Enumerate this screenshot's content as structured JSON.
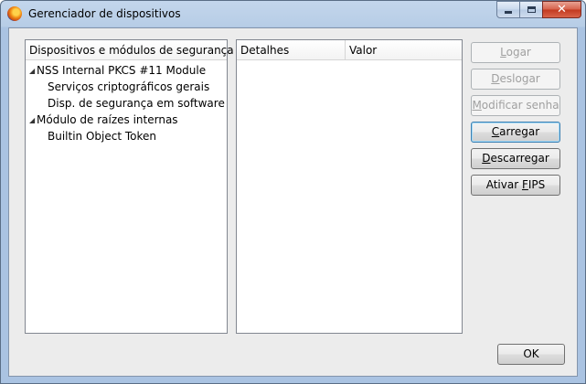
{
  "window": {
    "title": "Gerenciador de dispositivos",
    "icon": "firefox-icon"
  },
  "tree": {
    "header": "Dispositivos e módulos de segurança",
    "items": [
      {
        "label": "NSS Internal PKCS #11 Module",
        "level": 0,
        "expanded": true
      },
      {
        "label": "Serviços criptográficos gerais",
        "level": 1
      },
      {
        "label": "Disp. de segurança em software",
        "level": 1
      },
      {
        "label": "Módulo de raízes internas",
        "level": 0,
        "expanded": true
      },
      {
        "label": "Builtin Object Token",
        "level": 1
      }
    ]
  },
  "details": {
    "col1": "Detalhes",
    "col2": "Valor"
  },
  "buttons": {
    "login": {
      "pre": "",
      "key": "L",
      "post": "ogar",
      "enabled": false
    },
    "logout": {
      "pre": "",
      "key": "D",
      "post": "eslogar",
      "enabled": false
    },
    "change_password": {
      "pre": "",
      "key": "M",
      "post": "odificar senha",
      "enabled": false
    },
    "load": {
      "pre": "",
      "key": "C",
      "post": "arregar",
      "enabled": true
    },
    "unload": {
      "pre": "",
      "key": "D",
      "post": "escarregar",
      "enabled": true
    },
    "fips": {
      "pre": "Ativar ",
      "key": "F",
      "post": "IPS",
      "enabled": true
    },
    "ok": "OK"
  },
  "colors": {
    "titlebar": "#b7cde6",
    "client_bg": "#ececec",
    "close_button": "#c2391f",
    "focus_border": "#3c7fb1",
    "disabled_text": "#a0a0a0"
  }
}
